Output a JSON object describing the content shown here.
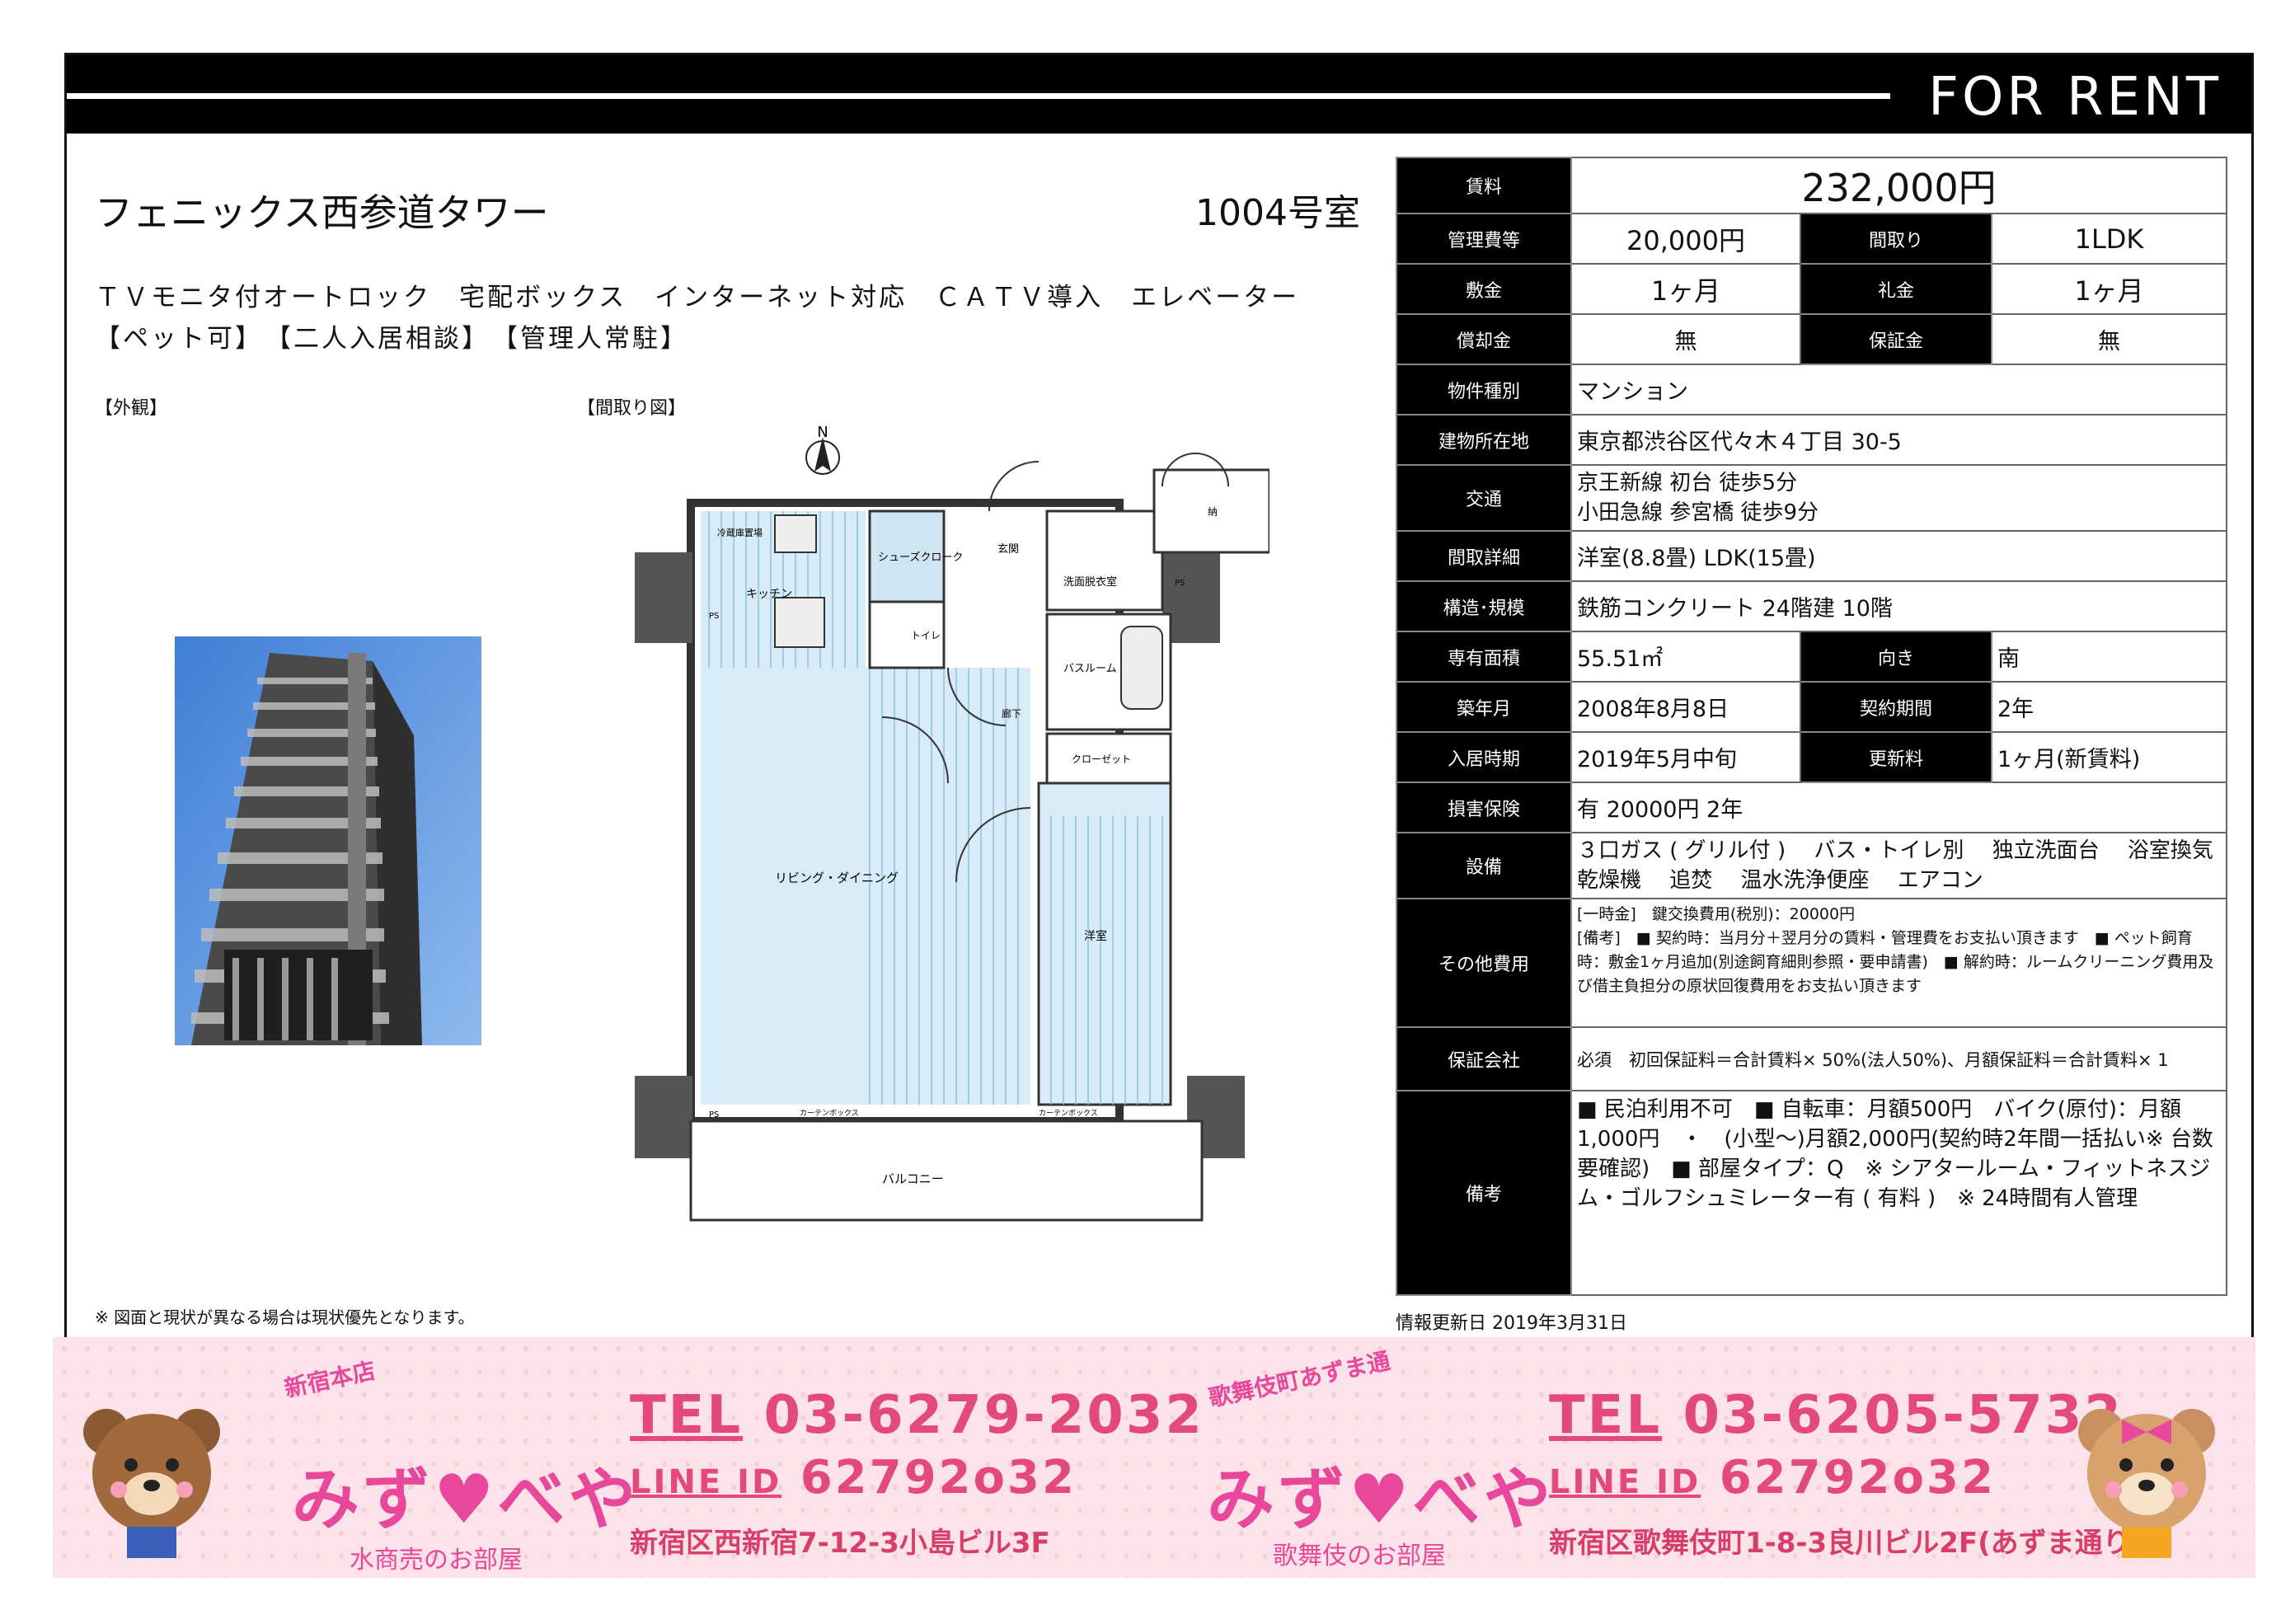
{
  "header": {
    "for_rent": "FOR RENT"
  },
  "property": {
    "name": "フェニックス西参道タワー",
    "room": "1004号室",
    "features_line1": "ＴＶモニタ付オートロック　宅配ボックス　インターネット対応　ＣＡＴＶ導入　エレベーター",
    "features_line2": "【ペット可】　【二人入居相談】　【管理人常駐】"
  },
  "labels": {
    "exterior": "【外観】",
    "floorplan": "【間取り図】"
  },
  "floorplan": {
    "north": "N",
    "rooms": {
      "fridge": "冷蔵庫置場",
      "kitchen": "キッチン",
      "shoes": "シューズクローク",
      "entrance": "玄関",
      "washroom": "洗面脱衣室",
      "toilet": "トイレ",
      "bath": "バスルーム",
      "hall": "廊下",
      "closet": "クローゼット",
      "living": "リビング・ダイニング",
      "western": "洋室",
      "balcony": "バルコニー",
      "curtain1": "カーテンボックス",
      "curtain2": "カーテンボックス",
      "ps1": "PS",
      "ps2": "PS",
      "ps3": "PS",
      "nook": "納"
    }
  },
  "note": "※ 図面と現状が異なる場合は現状優先となります。",
  "updated": "情報更新日 2019年3月31日",
  "info": {
    "rent_label": "賃料",
    "rent": "232,000円",
    "mgmt_label": "管理費等",
    "mgmt": "20,000円",
    "layout_label": "間取り",
    "layout": "1LDK",
    "deposit_label": "敷金",
    "deposit": "1ヶ月",
    "key_label": "礼金",
    "key": "1ヶ月",
    "amort_label": "償却金",
    "amort": "無",
    "guarantee_label": "保証金",
    "guarantee": "無",
    "type_label": "物件種別",
    "type": "マンション",
    "address_label": "建物所在地",
    "address": "東京都渋谷区代々木４丁目 30-5",
    "transport_label": "交通",
    "transport1": "京王新線 初台 徒歩5分",
    "transport2": "小田急線 参宮橋 徒歩9分",
    "detail_label": "間取詳細",
    "detail": "洋室(8.8畳) LDK(15畳)",
    "structure_label": "構造･規模",
    "structure": "鉄筋コンクリート 24階建 10階",
    "area_label": "専有面積",
    "area": "55.51㎡",
    "facing_label": "向き",
    "facing": "南",
    "built_label": "築年月",
    "built": "2008年8月8日",
    "term_label": "契約期間",
    "term": "2年",
    "movein_label": "入居時期",
    "movein": "2019年5月中旬",
    "renewal_label": "更新料",
    "renewal": "1ヶ月(新賃料)",
    "insurance_label": "損害保険",
    "insurance": "有  20000円 2年",
    "equip_label": "設備",
    "equip": "３口ガス ( グリル付 )　 バス・トイレ別　 独立洗面台　 浴室換気乾燥機　 追焚　 温水洗浄便座　 エアコン",
    "other_label": "その他費用",
    "other1": "[一時金]　鍵交換費用(税別)：20000円",
    "other2": "[備考]　■ 契約時：当月分＋翌月分の賃料・管理費をお支払い頂きます　■ ペット飼育時：敷金1ヶ月追加(別途飼育細則参照・要申請書)　■ 解約時：ルームクリーニング費用及び借主負担分の原状回復費用をお支払い頂きます",
    "company_label": "保証会社",
    "company": "必須　初回保証料＝合計賃料× 50%(法人50%)、月額保証料＝合計賃料× 1",
    "remarks_label": "備考",
    "remarks": "■ 民泊利用不可　■ 自転車：月額500円　バイク(原付)：月額1,000円　・　(小型～)月額2,000円(契約時2年間一括払い※ 台数要確認)　■ 部屋タイプ：Q　※ シアタールーム・フィットネスジム・ゴルフシュミレーター有 ( 有料 )　※ 24時間有人管理"
  },
  "banner": {
    "left": {
      "badge": "新宿本店",
      "logo": "みず♥べや",
      "sub": "水商売のお部屋",
      "tel_label": "TEL",
      "tel": "03-6279-2032",
      "line_label": "LINE ID",
      "line": "62792o32",
      "address": "新宿区西新宿7-12-3小島ビル3F"
    },
    "right": {
      "badge": "歌舞伎町あずま通",
      "logo": "みず♥べや",
      "sub": "歌舞伎のお部屋",
      "tel_label": "TEL",
      "tel": "03-6205-5732",
      "line_label": "LINE ID",
      "line": "62792o32",
      "address": "新宿区歌舞伎町1-8-3良川ビル2F(あずま通り)"
    }
  }
}
